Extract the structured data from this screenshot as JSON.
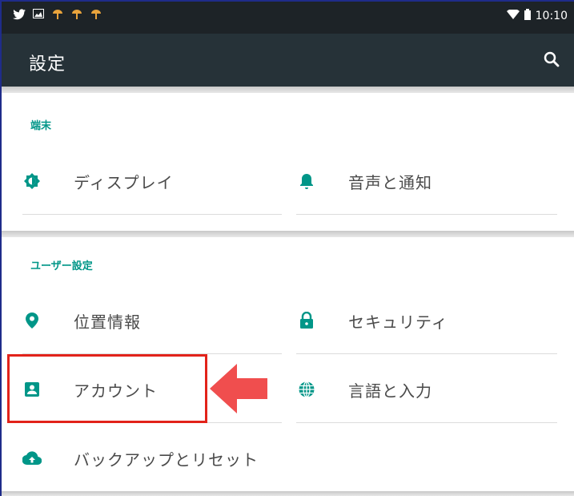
{
  "status_bar": {
    "left_icons": [
      "twitter-icon",
      "image-icon",
      "notification-icon",
      "notification-icon",
      "notification-icon"
    ],
    "time": "10:10"
  },
  "toolbar": {
    "title": "設定",
    "search_icon": "search-icon"
  },
  "sections": [
    {
      "title": "端末",
      "items": [
        {
          "label": "ディスプレイ",
          "icon": "brightness-icon"
        },
        {
          "label": "音声と通知",
          "icon": "bell-icon"
        }
      ]
    },
    {
      "title": "ユーザー設定",
      "items": [
        {
          "label": "位置情報",
          "icon": "location-icon"
        },
        {
          "label": "セキュリティ",
          "icon": "lock-icon"
        },
        {
          "label": "アカウント",
          "icon": "account-icon"
        },
        {
          "label": "言語と入力",
          "icon": "globe-icon"
        },
        {
          "label": "バックアップとリセット",
          "icon": "cloud-upload-icon"
        }
      ]
    }
  ],
  "colors": {
    "status_bar": "#1d2327",
    "toolbar": "#263238",
    "accent": "#009688",
    "highlight": "#e2231a",
    "arrow": "#f04e4e"
  }
}
